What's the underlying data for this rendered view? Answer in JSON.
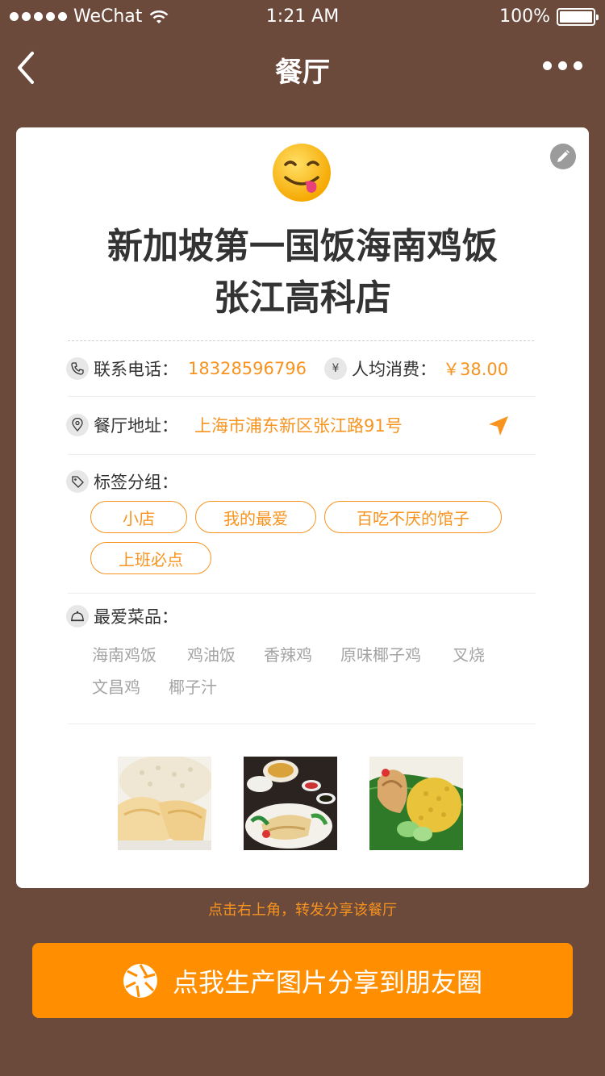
{
  "status_bar": {
    "carrier": "WeChat",
    "time": "1:21 AM",
    "battery": "100%",
    "battery_level": 1.0
  },
  "nav": {
    "title": "餐厅",
    "back_icon": "chevron-left-icon",
    "more_icon": "more-dots-icon"
  },
  "card": {
    "emoji": "yummy-face-emoji",
    "name_line1": "新加坡第一国饭海南鸡饭",
    "name_line2": "张江高科店",
    "phone_label": "联系电话：",
    "phone_value": "18328596796",
    "avg_label": "人均消费：",
    "avg_value": "￥38.00",
    "address_label": "餐厅地址：",
    "address_value": "上海市浦东新区张江路91号",
    "tags_label": "标签分组：",
    "tags": [
      "小店",
      "我的最爱",
      "百吃不厌的馆子",
      "上班必点"
    ],
    "dishes_label": "最爱菜品：",
    "dishes": [
      "海南鸡饭",
      "鸡油饭",
      "香辣鸡",
      "原味椰子鸡",
      "叉烧",
      "文昌鸡",
      "椰子汁"
    ]
  },
  "share_hint": "点击右上角，转发分享该餐厅",
  "share_button": "点我生产图片分享到朋友圈",
  "colors": {
    "background": "#6b4a3c",
    "accent": "#f7931e",
    "button": "#ff8f00"
  }
}
